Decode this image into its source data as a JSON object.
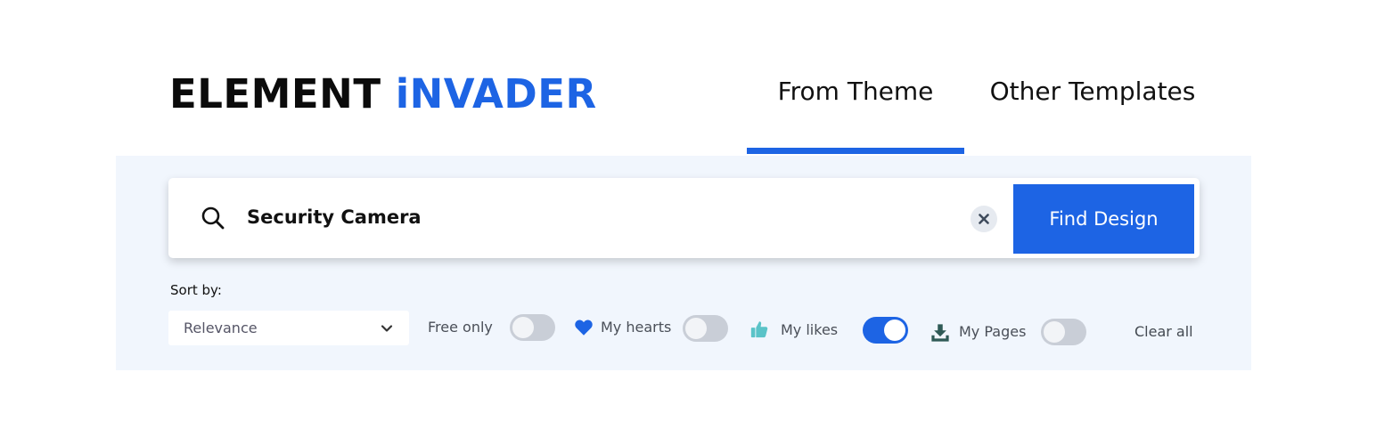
{
  "logo": {
    "part1": "ELEMENT",
    "part2": "iNVADER"
  },
  "tabs": [
    {
      "label": "From Theme",
      "active": true
    },
    {
      "label": "Other Templates",
      "active": false
    }
  ],
  "search": {
    "value": "Security Camera",
    "placeholder": "",
    "button_label": "Find Design"
  },
  "sort": {
    "label": "Sort by:",
    "selected": "Relevance"
  },
  "filters": {
    "free_only": {
      "label": "Free only",
      "on": false
    },
    "my_hearts": {
      "label": "My hearts",
      "icon": "heart-icon",
      "on": false
    },
    "my_likes": {
      "label": "My likes",
      "icon": "thumbs-up-icon",
      "on": true
    },
    "my_pages": {
      "label": "My Pages",
      "icon": "download-icon",
      "on": false
    }
  },
  "clear_all": "Clear all",
  "colors": {
    "accent": "#1d64e4",
    "panel_bg": "#f1f6fd",
    "likes_icon": "#5ac3c8",
    "pages_icon": "#2f5a56"
  }
}
